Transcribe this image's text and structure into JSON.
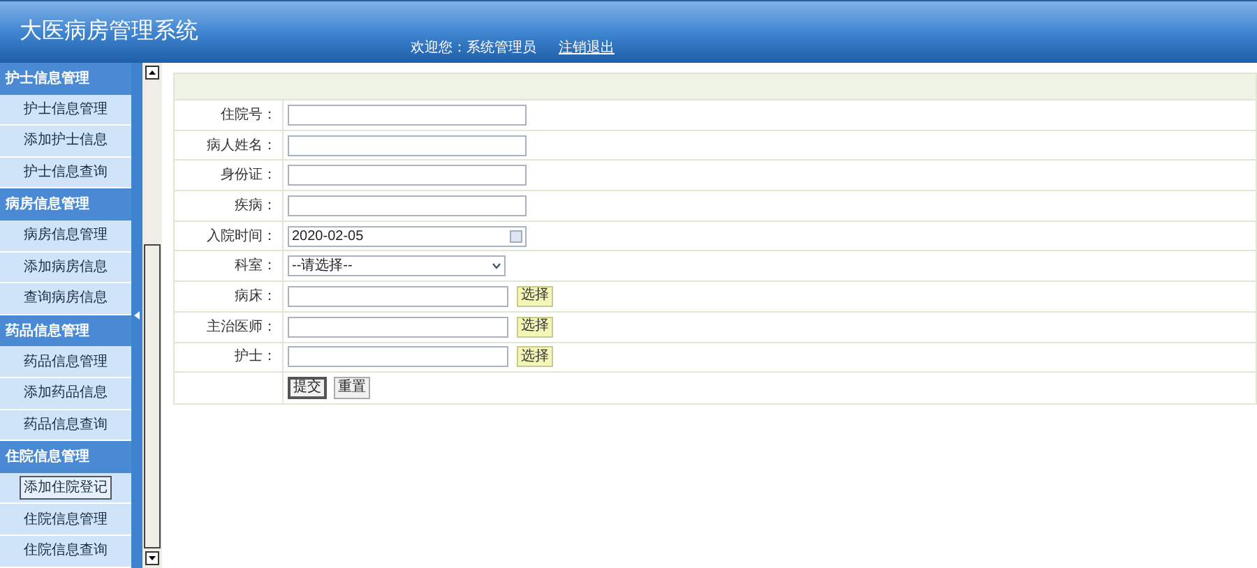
{
  "header": {
    "title": "大医病房管理系统",
    "welcome": "欢迎您：系统管理员",
    "logout": "注销退出"
  },
  "sidebar": {
    "groups": [
      {
        "title": "护士信息管理",
        "items": [
          {
            "label": "护士信息管理",
            "selected": false
          },
          {
            "label": "添加护士信息",
            "selected": false
          },
          {
            "label": "护士信息查询",
            "selected": false
          }
        ]
      },
      {
        "title": "病房信息管理",
        "items": [
          {
            "label": "病房信息管理",
            "selected": false
          },
          {
            "label": "添加病房信息",
            "selected": false
          },
          {
            "label": "查询病房信息",
            "selected": false
          }
        ]
      },
      {
        "title": "药品信息管理",
        "items": [
          {
            "label": "药品信息管理",
            "selected": false
          },
          {
            "label": "添加药品信息",
            "selected": false
          },
          {
            "label": "药品信息查询",
            "selected": false
          }
        ]
      },
      {
        "title": "住院信息管理",
        "items": [
          {
            "label": "添加住院登记",
            "selected": true
          },
          {
            "label": "住院信息管理",
            "selected": false
          },
          {
            "label": "住院信息查询",
            "selected": false
          }
        ]
      }
    ]
  },
  "form": {
    "fields": [
      {
        "label": "住院号：",
        "kind": "text"
      },
      {
        "label": "病人姓名：",
        "kind": "text"
      },
      {
        "label": "身份证：",
        "kind": "text"
      },
      {
        "label": "疾病：",
        "kind": "text"
      },
      {
        "label": "入院时间：",
        "kind": "date",
        "value": "2020-02-05"
      },
      {
        "label": "科室：",
        "kind": "select",
        "value": "--请选择--"
      },
      {
        "label": "病床：",
        "kind": "picker",
        "button": "选择"
      },
      {
        "label": "主治医师：",
        "kind": "picker",
        "button": "选择"
      },
      {
        "label": "护士：",
        "kind": "picker",
        "button": "选择"
      }
    ],
    "buttons": [
      "提交",
      "重置"
    ]
  }
}
